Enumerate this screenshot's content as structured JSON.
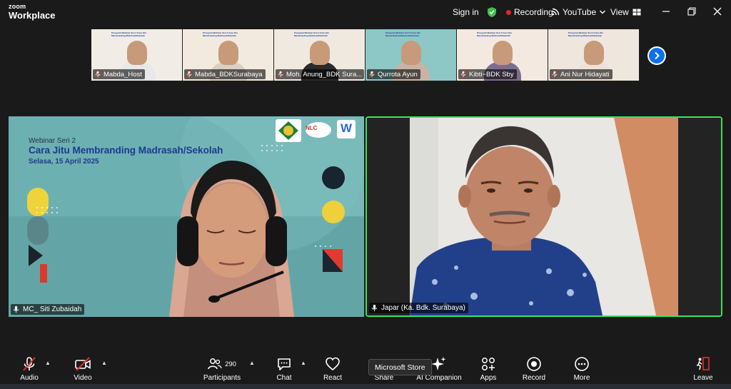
{
  "titlebar": {
    "brand_small": "zoom",
    "brand_big": "Workplace",
    "signin": "Sign in",
    "recording": "Recording",
    "youtube": "YouTube",
    "view": "View",
    "colors": {
      "shield": "#3ec24b",
      "recording_dot": "#e02828"
    }
  },
  "thumbnails": [
    {
      "name": "Mabda_Host",
      "bg": "#f1ece5",
      "shirt": "#e8e8e8"
    },
    {
      "name": "Mabda_BDKSurabaya",
      "bg": "#f3eadf",
      "shirt": "#d9cfc4"
    },
    {
      "name": "Moh. Anung_BDK Sura...",
      "bg": "#efe9e0",
      "shirt": "#2b2b2b"
    },
    {
      "name": "Qurrota Ayun",
      "bg": "#8dc7c6",
      "shirt": "#c9b3a5"
    },
    {
      "name": "Kibti~BDK Sby",
      "bg": "#f3e9e1",
      "shirt": "#7d6d8f"
    },
    {
      "name": "Ani Nur Hidayati",
      "bg": "#efe6de",
      "shirt": "#ede2d8"
    }
  ],
  "thumb_slide_text": "Prasyarat Webinar Seri 2 Cara Jitu Membranding Madrasah/Sekolah",
  "main_left": {
    "series": "Webinar Seri 2",
    "title": "Cara Jitu Membranding Madrasah/Sekolah",
    "date": "Selasa, 15 April 2025",
    "name": "MC_ Siti Zubaidah",
    "logos": [
      "NLC",
      "W"
    ]
  },
  "main_right": {
    "name": "Japar (Ka. Bdk. Surabaya)",
    "active_border": "#3ee05b"
  },
  "toolbar": {
    "audio": "Audio",
    "video": "Video",
    "participants": "Participants",
    "participants_count": "290",
    "chat": "Chat",
    "react": "React",
    "share": "Share",
    "ai": "AI Companion",
    "apps": "Apps",
    "record": "Record",
    "more": "More",
    "leave": "Leave",
    "muted_color": "#e0322b",
    "share_color": "#2db85c"
  },
  "tooltip": "Microsoft Store"
}
